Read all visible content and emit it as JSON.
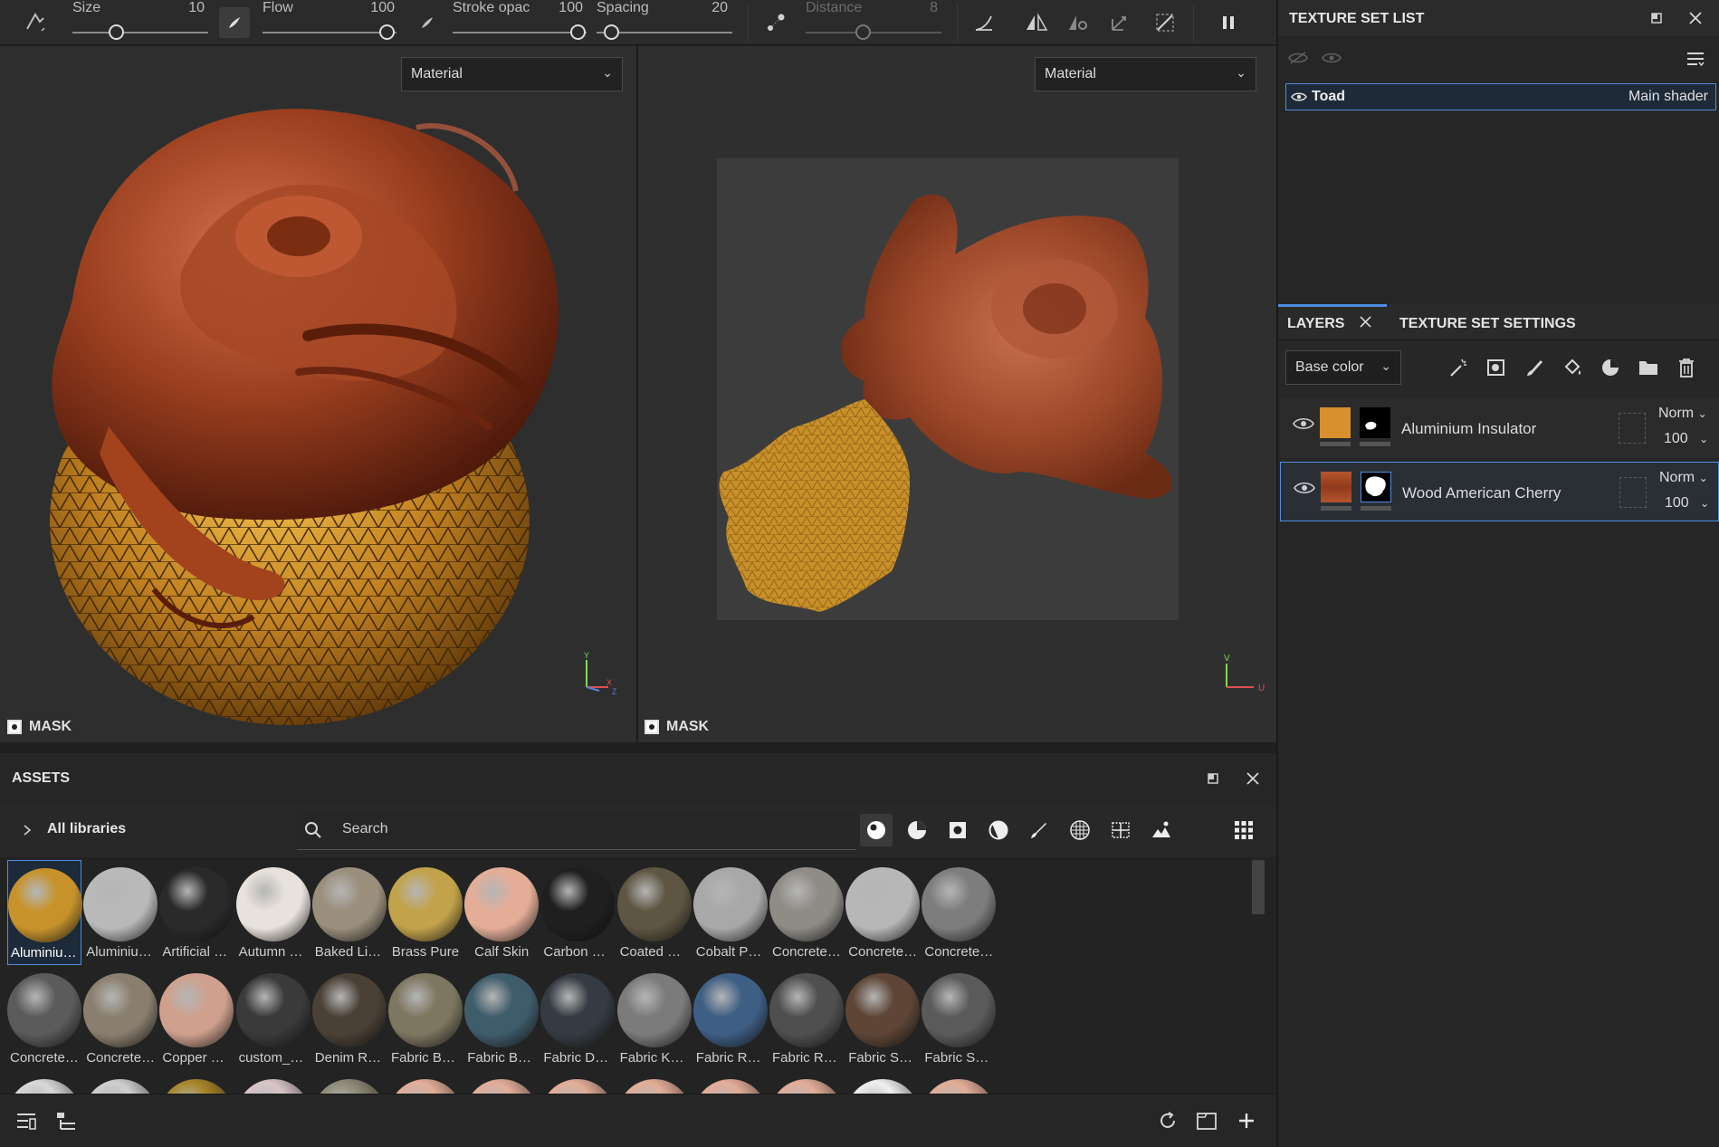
{
  "toolbar": {
    "size_label": "Size",
    "size_value": "10",
    "flow_label": "Flow",
    "flow_value": "100",
    "stroke_label": "Stroke opac",
    "stroke_value": "100",
    "spacing_label": "Spacing",
    "spacing_value": "20",
    "distance_label": "Distance",
    "distance_value": "8"
  },
  "viewport_3d": {
    "dropdown": "Material",
    "mask_label": "MASK",
    "axes": [
      "Y",
      "X",
      "Z"
    ]
  },
  "viewport_uv": {
    "dropdown": "Material",
    "mask_label": "MASK",
    "axes": [
      "V",
      "U"
    ]
  },
  "assets": {
    "title": "ASSETS",
    "libraries_label": "All libraries",
    "search_placeholder": "Search",
    "row1": [
      {
        "label": "Aluminium...",
        "color": "#c8922a",
        "selected": true
      },
      {
        "label": "Aluminium...",
        "color": "#b9b9b9"
      },
      {
        "label": "Artificial Le...",
        "color": "#2a2a2a"
      },
      {
        "label": "Autumn Le...",
        "color": "#e8e2dc"
      },
      {
        "label": "Baked Ligh...",
        "color": "#9a8e7c"
      },
      {
        "label": "Brass Pure",
        "color": "#c2a24a"
      },
      {
        "label": "Calf Skin",
        "color": "#e3ad98"
      },
      {
        "label": "Carbon Fib...",
        "color": "#1f1f1f"
      },
      {
        "label": "Coated Me...",
        "color": "#5e5642"
      },
      {
        "label": "Cobalt Pure",
        "color": "#a8a8a8"
      },
      {
        "label": "Concrete B...",
        "color": "#8f8c86"
      },
      {
        "label": "Concrete C...",
        "color": "#b7b7b7"
      },
      {
        "label": "Concrete ...",
        "color": "#7d7d7d"
      }
    ],
    "row2": [
      {
        "label": "Concrete S...",
        "color": "#5b5b5b"
      },
      {
        "label": "Concrete S...",
        "color": "#8a7f6e"
      },
      {
        "label": "Copper Pure",
        "color": "#cfa08e"
      },
      {
        "label": "custom_sti...",
        "color": "#3a3a3a"
      },
      {
        "label": "Denim Rivet",
        "color": "#4a4036"
      },
      {
        "label": "Fabric Bam...",
        "color": "#7d7660"
      },
      {
        "label": "Fabric Bas...",
        "color": "#3f5c6b"
      },
      {
        "label": "Fabric Den...",
        "color": "#353b42"
      },
      {
        "label": "Fabric Knit...",
        "color": "#7b7b7b"
      },
      {
        "label": "Fabric Rou...",
        "color": "#3e5e84"
      },
      {
        "label": "Fabric Rou...",
        "color": "#4f4f4f"
      },
      {
        "label": "Fabric Soft...",
        "color": "#5e4536"
      },
      {
        "label": "Fabric Suit ...",
        "color": "#5a5a5a"
      }
    ]
  },
  "texture_set": {
    "title": "TEXTURE SET LIST",
    "item_name": "Toad",
    "item_shader": "Main shader"
  },
  "layers": {
    "tab_layers": "LAYERS",
    "tab_settings": "TEXTURE SET SETTINGS",
    "channel": "Base color",
    "items": [
      {
        "name": "Aluminium Insulator",
        "blend": "Norm",
        "opacity": "100",
        "thumb": "#d8902e"
      },
      {
        "name": "Wood American Cherry",
        "blend": "Norm",
        "opacity": "100",
        "thumb": "#a24a26"
      }
    ]
  },
  "colors": {
    "accent": "#4f8de0",
    "wood": "#9b3f1f",
    "gold": "#c8902a"
  }
}
